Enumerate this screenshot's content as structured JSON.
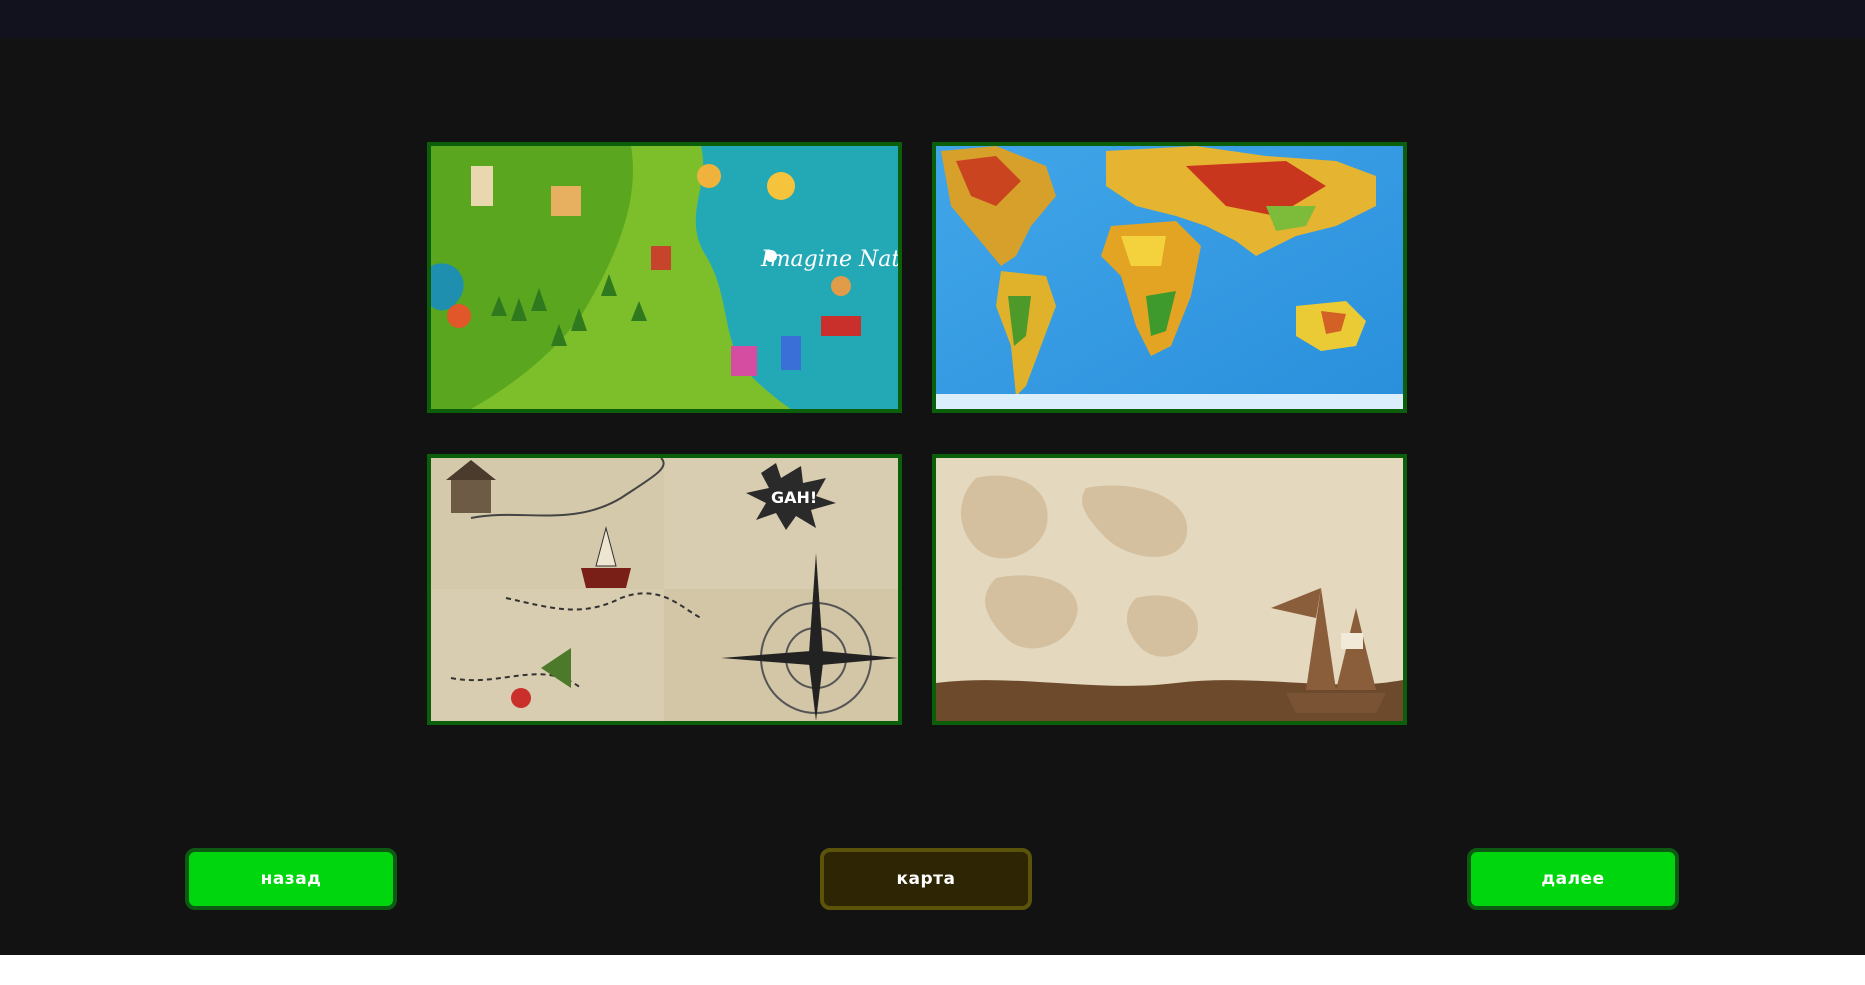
{
  "gallery": {
    "tiles": [
      {
        "icon": "fantasy-map-image",
        "caption": "Imagine Nation"
      },
      {
        "icon": "world-physical-map-image"
      },
      {
        "icon": "treasure-map-image",
        "caption": "GAH!"
      },
      {
        "icon": "pirate-ship-map-image"
      }
    ]
  },
  "nav": {
    "back_label": "назад",
    "map_label": "карта",
    "next_label": "далее"
  },
  "colors": {
    "background": "#121212",
    "topbar": "#12121e",
    "button_green": "#00d60e",
    "button_green_border": "#0d5a12",
    "button_map": "#2d2504",
    "button_map_border": "#5a5309",
    "tile_border": "#0b5f0b"
  }
}
